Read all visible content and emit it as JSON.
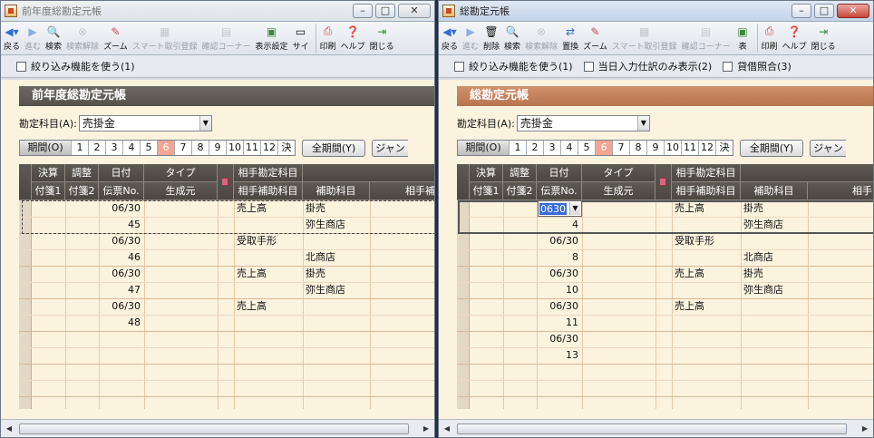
{
  "left_window": {
    "title": "前年度総勘定元帳",
    "toolbar": [
      {
        "label": "戻る",
        "icon": "back-arrow-icon",
        "enabled": true
      },
      {
        "label": "進む",
        "icon": "forward-arrow-icon",
        "enabled": false
      },
      {
        "label": "検索",
        "icon": "search-icon",
        "enabled": true
      },
      {
        "label": "検索解除",
        "icon": "search-clear-icon",
        "enabled": false
      },
      {
        "label": "ズーム",
        "icon": "zoom-icon",
        "enabled": true
      },
      {
        "label": "スマート取引登録",
        "icon": "smart-transaction-icon",
        "enabled": false
      },
      {
        "label": "確認コーナー",
        "icon": "check-corner-icon",
        "enabled": false
      },
      {
        "label": "表示設定",
        "icon": "display-settings-icon",
        "enabled": true
      },
      {
        "label": "サイ",
        "icon": "size-icon",
        "enabled": true
      },
      {
        "label": "印刷",
        "icon": "print-icon",
        "enabled": true
      },
      {
        "label": "ヘルプ",
        "icon": "help-icon",
        "enabled": true
      },
      {
        "label": "閉じる",
        "icon": "close-door-icon",
        "enabled": true
      }
    ],
    "filters": [
      "絞り込み機能を使う(1)"
    ],
    "header_title": "前年度総勘定元帳",
    "account_label": "勘定科目(A):",
    "account_value": "売掛金",
    "period_label": "期間(O)",
    "periods": [
      "1",
      "2",
      "3",
      "4",
      "5",
      "6",
      "7",
      "8",
      "9",
      "10",
      "11",
      "12",
      "決"
    ],
    "current_period": "6",
    "all_period_button": "全期間(Y)",
    "jump_button": "ジャン",
    "columns_top": [
      "決算",
      "調整",
      "日付",
      "タイプ",
      "相手勘定科目"
    ],
    "columns_bottom": [
      "付箋1",
      "付箋2",
      "伝票No.",
      "生成元",
      "相手補助科目",
      "補助科目",
      "相手補"
    ],
    "rows": [
      {
        "date": "06/30",
        "no": "45",
        "account": "売上高",
        "sub": "掛売",
        "sub2": "弥生商店"
      },
      {
        "date": "06/30",
        "no": "46",
        "account": "受取手形",
        "sub": "",
        "sub2": "北商店"
      },
      {
        "date": "06/30",
        "no": "47",
        "account": "売上高",
        "sub": "掛売",
        "sub2": "弥生商店"
      },
      {
        "date": "06/30",
        "no": "48",
        "account": "売上高",
        "sub": "",
        "sub2": ""
      }
    ]
  },
  "right_window": {
    "title": "総勘定元帳",
    "toolbar": [
      {
        "label": "戻る",
        "icon": "back-arrow-icon",
        "enabled": true
      },
      {
        "label": "進む",
        "icon": "forward-arrow-icon",
        "enabled": false
      },
      {
        "label": "削除",
        "icon": "delete-icon",
        "enabled": true
      },
      {
        "label": "検索",
        "icon": "search-icon",
        "enabled": true
      },
      {
        "label": "検索解除",
        "icon": "search-clear-icon",
        "enabled": false
      },
      {
        "label": "置換",
        "icon": "replace-icon",
        "enabled": true
      },
      {
        "label": "ズーム",
        "icon": "zoom-icon",
        "enabled": true
      },
      {
        "label": "スマート取引登録",
        "icon": "smart-transaction-icon",
        "enabled": false
      },
      {
        "label": "確認コーナー",
        "icon": "check-corner-icon",
        "enabled": false
      },
      {
        "label": "表",
        "icon": "display-settings-icon",
        "enabled": true
      },
      {
        "label": "印刷",
        "icon": "print-icon",
        "enabled": true
      },
      {
        "label": "ヘルプ",
        "icon": "help-icon",
        "enabled": true
      },
      {
        "label": "閉じる",
        "icon": "close-door-icon",
        "enabled": true
      }
    ],
    "filters": [
      "絞り込み機能を使う(1)",
      "当日入力仕訳のみ表示(2)",
      "貸借照合(3)"
    ],
    "header_title": "総勘定元帳",
    "account_label": "勘定科目(A):",
    "account_value": "売掛金",
    "period_label": "期間(O)",
    "periods": [
      "1",
      "2",
      "3",
      "4",
      "5",
      "6",
      "7",
      "8",
      "9",
      "10",
      "11",
      "12",
      "決"
    ],
    "current_period": "6",
    "all_period_button": "全期間(Y)",
    "jump_button": "ジャン",
    "columns_top": [
      "決算",
      "調整",
      "日付",
      "タイプ",
      "相手勘定科目"
    ],
    "columns_bottom": [
      "付箋1",
      "付箋2",
      "伝票No.",
      "生成元",
      "相手補助科目",
      "補助科目",
      "相手"
    ],
    "edit_value": "0630",
    "rows": [
      {
        "date": "",
        "no": "4",
        "account": "売上高",
        "sub": "掛売",
        "sub2": "弥生商店"
      },
      {
        "date": "06/30",
        "no": "8",
        "account": "受取手形",
        "sub": "",
        "sub2": "北商店"
      },
      {
        "date": "06/30",
        "no": "10",
        "account": "売上高",
        "sub": "掛売",
        "sub2": "弥生商店"
      },
      {
        "date": "06/30",
        "no": "11",
        "account": "売上高",
        "sub": "",
        "sub2": ""
      },
      {
        "date": "06/30",
        "no": "13",
        "account": "",
        "sub": "",
        "sub2": ""
      }
    ]
  },
  "colors": {
    "grid_bg": "#fcf3df",
    "header_left": "#5a544e",
    "header_right": "#c3815c",
    "current_period": "#f0a693",
    "selection": "#3a6cd8"
  }
}
